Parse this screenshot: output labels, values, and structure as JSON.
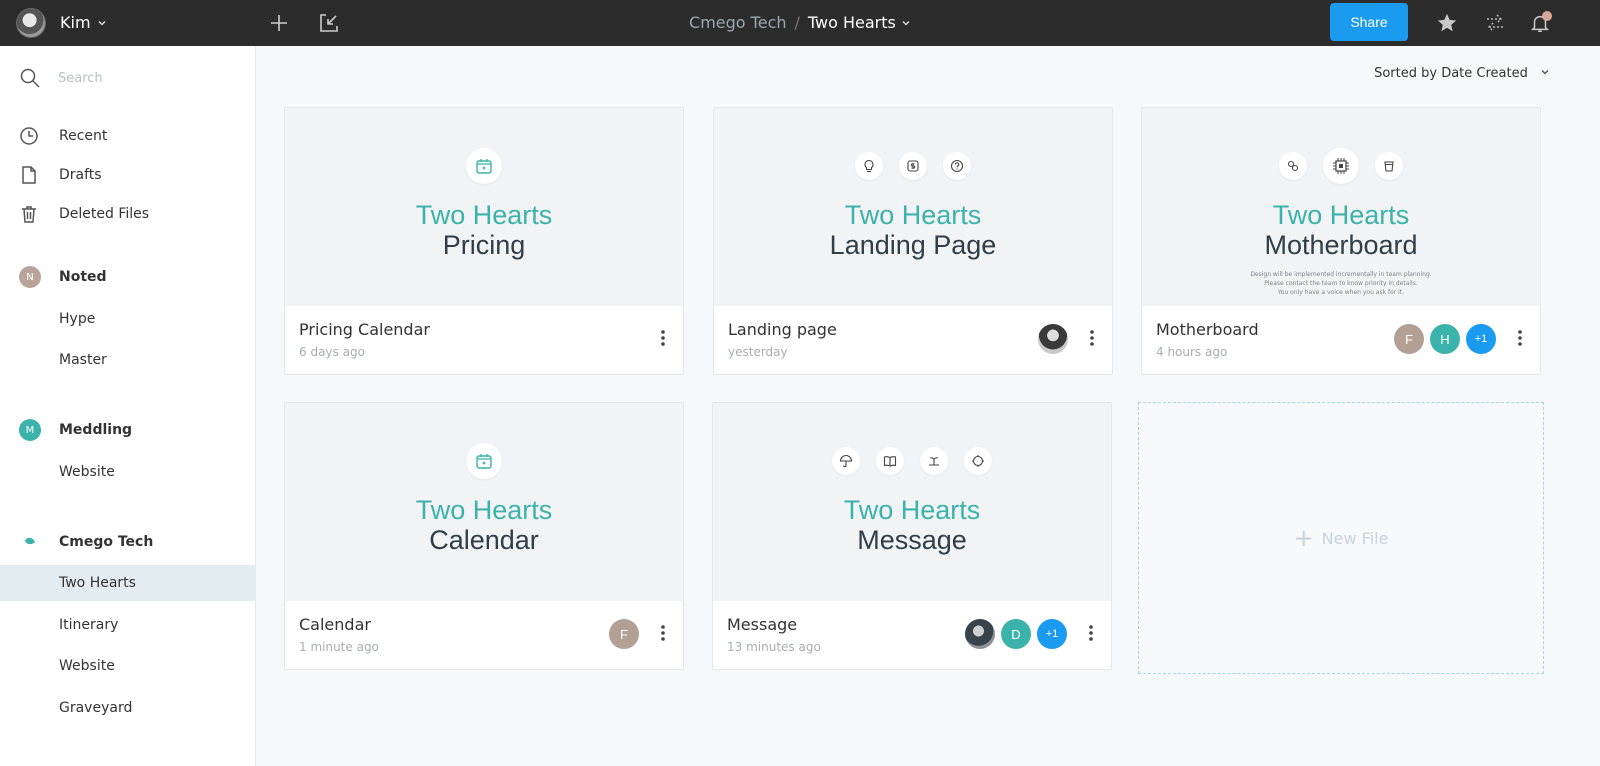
{
  "header": {
    "user_name": "Kim",
    "team_crumb": "Cmego Tech",
    "separator": "/",
    "project_crumb": "Two Hearts",
    "share_label": "Share"
  },
  "sidebar": {
    "search_placeholder": "Search",
    "nav": [
      {
        "label": "Recent",
        "icon": "clock-icon"
      },
      {
        "label": "Drafts",
        "icon": "file-icon"
      },
      {
        "label": "Deleted Files",
        "icon": "trash-icon"
      }
    ],
    "teams": [
      {
        "label": "Noted",
        "initial": "N",
        "color": "#b8a49a",
        "projects": [
          "Hype",
          "Master"
        ]
      },
      {
        "label": "Meddling",
        "initial": "M",
        "color": "#3bb3aa",
        "projects": [
          "Website"
        ]
      },
      {
        "label": "Cmego Tech",
        "initial": "",
        "color": "#3bb3aa",
        "projects": [
          "Two Hearts",
          "Itinerary",
          "Website",
          "Graveyard"
        ]
      }
    ],
    "active_project": "Two Hearts"
  },
  "main": {
    "sort_label": "Sorted by Date Created",
    "new_file_label": "New File",
    "files": [
      {
        "title_line1": "Two Hearts",
        "title_line2": "Pricing",
        "name": "Pricing Calendar",
        "date": "6 days ago",
        "icons": [
          "calendar-icon"
        ],
        "avatars": []
      },
      {
        "title_line1": "Two Hearts",
        "title_line2": "Landing Page",
        "name": "Landing page",
        "date": "yesterday",
        "icons": [
          "lightbulb-icon",
          "dollar-icon",
          "question-icon"
        ],
        "avatars": [
          "photo"
        ]
      },
      {
        "title_line1": "Two Hearts",
        "title_line2": "Motherboard",
        "name": "Motherboard",
        "date": "4 hours ago",
        "icons": [
          "bacteria-icon",
          "circuit-icon",
          "cup-icon"
        ],
        "avatars": [
          "F",
          "H",
          "+1"
        ],
        "small_text": [
          "Design will be implemented incrementally in team planning.",
          "Please contact the team to know priority in details.",
          "You only have a voice when you ask for it."
        ]
      },
      {
        "title_line1": "Two Hearts",
        "title_line2": "Calendar",
        "name": "Calendar",
        "date": "1 minute ago",
        "icons": [
          "calendar-icon"
        ],
        "avatars": [
          "F"
        ]
      },
      {
        "title_line1": "Two Hearts",
        "title_line2": "Message",
        "name": "Message",
        "date": "13 minutes ago",
        "icons": [
          "umbrella-icon",
          "book-icon",
          "island-icon",
          "target-icon"
        ],
        "avatars": [
          "photo",
          "D",
          "+1"
        ]
      }
    ]
  },
  "colors": {
    "accent_teal": "#3bb3aa",
    "share_blue": "#1a9bf0",
    "avatar_tan": "#b3a095",
    "avatar_teal": "#3bb3aa",
    "avatar_blue": "#1a9bf0"
  }
}
